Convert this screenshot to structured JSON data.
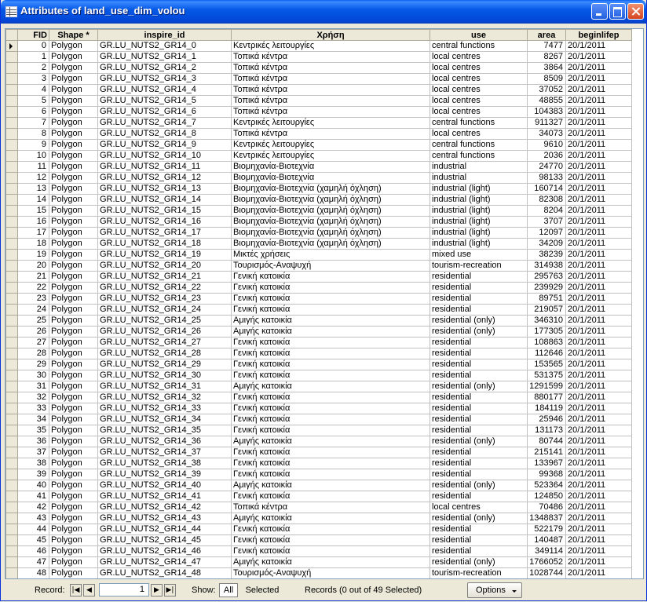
{
  "window": {
    "title": "Attributes of land_use_dim_volou"
  },
  "columns": [
    "FID",
    "Shape *",
    "inspire_id",
    "Χρήση",
    "use",
    "area",
    "beginlifep"
  ],
  "rows": [
    [
      "0",
      "Polygon",
      "GR.LU_NUTS2_GR14_0",
      "Κεντρικές λειτουργίες",
      "central functions",
      "7477",
      "20/1/2011"
    ],
    [
      "1",
      "Polygon",
      "GR.LU_NUTS2_GR14_1",
      "Τοπικά κέντρα",
      "local centres",
      "8267",
      "20/1/2011"
    ],
    [
      "2",
      "Polygon",
      "GR.LU_NUTS2_GR14_2",
      "Τοπικά κέντρα",
      "local centres",
      "3864",
      "20/1/2011"
    ],
    [
      "3",
      "Polygon",
      "GR.LU_NUTS2_GR14_3",
      "Τοπικά κέντρα",
      "local centres",
      "8509",
      "20/1/2011"
    ],
    [
      "4",
      "Polygon",
      "GR.LU_NUTS2_GR14_4",
      "Τοπικά κέντρα",
      "local centres",
      "37052",
      "20/1/2011"
    ],
    [
      "5",
      "Polygon",
      "GR.LU_NUTS2_GR14_5",
      "Τοπικά κέντρα",
      "local centres",
      "48855",
      "20/1/2011"
    ],
    [
      "6",
      "Polygon",
      "GR.LU_NUTS2_GR14_6",
      "Τοπικά κέντρα",
      "local centres",
      "104383",
      "20/1/2011"
    ],
    [
      "7",
      "Polygon",
      "GR.LU_NUTS2_GR14_7",
      "Κεντρικές λειτουργίες",
      "central functions",
      "911327",
      "20/1/2011"
    ],
    [
      "8",
      "Polygon",
      "GR.LU_NUTS2_GR14_8",
      "Τοπικά κέντρα",
      "local centres",
      "34073",
      "20/1/2011"
    ],
    [
      "9",
      "Polygon",
      "GR.LU_NUTS2_GR14_9",
      "Κεντρικές λειτουργίες",
      "central functions",
      "9610",
      "20/1/2011"
    ],
    [
      "10",
      "Polygon",
      "GR.LU_NUTS2_GR14_10",
      "Κεντρικές λειτουργίες",
      "central functions",
      "2036",
      "20/1/2011"
    ],
    [
      "11",
      "Polygon",
      "GR.LU_NUTS2_GR14_11",
      "Βιομηχανία-Βιοτεχνία",
      "industrial",
      "24770",
      "20/1/2011"
    ],
    [
      "12",
      "Polygon",
      "GR.LU_NUTS2_GR14_12",
      "Βιομηχανία-Βιοτεχνία",
      "industrial",
      "98133",
      "20/1/2011"
    ],
    [
      "13",
      "Polygon",
      "GR.LU_NUTS2_GR14_13",
      "Βιομηχανία-Βιοτεχνία (χαμηλή όχληση)",
      "industrial (light)",
      "160714",
      "20/1/2011"
    ],
    [
      "14",
      "Polygon",
      "GR.LU_NUTS2_GR14_14",
      "Βιομηχανία-Βιοτεχνία (χαμηλή όχληση)",
      "industrial (light)",
      "82308",
      "20/1/2011"
    ],
    [
      "15",
      "Polygon",
      "GR.LU_NUTS2_GR14_15",
      "Βιομηχανία-Βιοτεχνία (χαμηλή όχληση)",
      "industrial (light)",
      "8204",
      "20/1/2011"
    ],
    [
      "16",
      "Polygon",
      "GR.LU_NUTS2_GR14_16",
      "Βιομηχανία-Βιοτεχνία (χαμηλή όχληση)",
      "industrial (light)",
      "3707",
      "20/1/2011"
    ],
    [
      "17",
      "Polygon",
      "GR.LU_NUTS2_GR14_17",
      "Βιομηχανία-Βιοτεχνία (χαμηλή όχληση)",
      "industrial (light)",
      "12097",
      "20/1/2011"
    ],
    [
      "18",
      "Polygon",
      "GR.LU_NUTS2_GR14_18",
      "Βιομηχανία-Βιοτεχνία (χαμηλή όχληση)",
      "industrial (light)",
      "34209",
      "20/1/2011"
    ],
    [
      "19",
      "Polygon",
      "GR.LU_NUTS2_GR14_19",
      "Μικτές χρήσεις",
      "mixed use",
      "38239",
      "20/1/2011"
    ],
    [
      "20",
      "Polygon",
      "GR.LU_NUTS2_GR14_20",
      "Τουρισμός-Αναψυχή",
      "tourism-recreation",
      "314938",
      "20/1/2011"
    ],
    [
      "21",
      "Polygon",
      "GR.LU_NUTS2_GR14_21",
      "Γενική κατοικία",
      "residential",
      "295763",
      "20/1/2011"
    ],
    [
      "22",
      "Polygon",
      "GR.LU_NUTS2_GR14_22",
      "Γενική κατοικία",
      "residential",
      "239929",
      "20/1/2011"
    ],
    [
      "23",
      "Polygon",
      "GR.LU_NUTS2_GR14_23",
      "Γενική κατοικία",
      "residential",
      "89751",
      "20/1/2011"
    ],
    [
      "24",
      "Polygon",
      "GR.LU_NUTS2_GR14_24",
      "Γενική κατοικία",
      "residential",
      "219057",
      "20/1/2011"
    ],
    [
      "25",
      "Polygon",
      "GR.LU_NUTS2_GR14_25",
      "Αμιγής κατοικία",
      "residential (only)",
      "346310",
      "20/1/2011"
    ],
    [
      "26",
      "Polygon",
      "GR.LU_NUTS2_GR14_26",
      "Αμιγής κατοικία",
      "residential (only)",
      "177305",
      "20/1/2011"
    ],
    [
      "27",
      "Polygon",
      "GR.LU_NUTS2_GR14_27",
      "Γενική κατοικία",
      "residential",
      "108863",
      "20/1/2011"
    ],
    [
      "28",
      "Polygon",
      "GR.LU_NUTS2_GR14_28",
      "Γενική κατοικία",
      "residential",
      "112646",
      "20/1/2011"
    ],
    [
      "29",
      "Polygon",
      "GR.LU_NUTS2_GR14_29",
      "Γενική κατοικία",
      "residential",
      "153565",
      "20/1/2011"
    ],
    [
      "30",
      "Polygon",
      "GR.LU_NUTS2_GR14_30",
      "Γενική κατοικία",
      "residential",
      "531375",
      "20/1/2011"
    ],
    [
      "31",
      "Polygon",
      "GR.LU_NUTS2_GR14_31",
      "Αμιγής κατοικία",
      "residential (only)",
      "1291599",
      "20/1/2011"
    ],
    [
      "32",
      "Polygon",
      "GR.LU_NUTS2_GR14_32",
      "Γενική κατοικία",
      "residential",
      "880177",
      "20/1/2011"
    ],
    [
      "33",
      "Polygon",
      "GR.LU_NUTS2_GR14_33",
      "Γενική κατοικία",
      "residential",
      "184119",
      "20/1/2011"
    ],
    [
      "34",
      "Polygon",
      "GR.LU_NUTS2_GR14_34",
      "Γενική κατοικία",
      "residential",
      "25946",
      "20/1/2011"
    ],
    [
      "35",
      "Polygon",
      "GR.LU_NUTS2_GR14_35",
      "Γενική κατοικία",
      "residential",
      "131173",
      "20/1/2011"
    ],
    [
      "36",
      "Polygon",
      "GR.LU_NUTS2_GR14_36",
      "Αμιγής κατοικία",
      "residential (only)",
      "80744",
      "20/1/2011"
    ],
    [
      "37",
      "Polygon",
      "GR.LU_NUTS2_GR14_37",
      "Γενική κατοικία",
      "residential",
      "215141",
      "20/1/2011"
    ],
    [
      "38",
      "Polygon",
      "GR.LU_NUTS2_GR14_38",
      "Γενική κατοικία",
      "residential",
      "133967",
      "20/1/2011"
    ],
    [
      "39",
      "Polygon",
      "GR.LU_NUTS2_GR14_39",
      "Γενική κατοικία",
      "residential",
      "99368",
      "20/1/2011"
    ],
    [
      "40",
      "Polygon",
      "GR.LU_NUTS2_GR14_40",
      "Αμιγής κατοικία",
      "residential (only)",
      "523364",
      "20/1/2011"
    ],
    [
      "41",
      "Polygon",
      "GR.LU_NUTS2_GR14_41",
      "Γενική κατοικία",
      "residential",
      "124850",
      "20/1/2011"
    ],
    [
      "42",
      "Polygon",
      "GR.LU_NUTS2_GR14_42",
      "Τοπικά κέντρα",
      "local centres",
      "70486",
      "20/1/2011"
    ],
    [
      "43",
      "Polygon",
      "GR.LU_NUTS2_GR14_43",
      "Αμιγής κατοικία",
      "residential (only)",
      "1348837",
      "20/1/2011"
    ],
    [
      "44",
      "Polygon",
      "GR.LU_NUTS2_GR14_44",
      "Γενική κατοικία",
      "residential",
      "522179",
      "20/1/2011"
    ],
    [
      "45",
      "Polygon",
      "GR.LU_NUTS2_GR14_45",
      "Γενική κατοικία",
      "residential",
      "140487",
      "20/1/2011"
    ],
    [
      "46",
      "Polygon",
      "GR.LU_NUTS2_GR14_46",
      "Γενική κατοικία",
      "residential",
      "349114",
      "20/1/2011"
    ],
    [
      "47",
      "Polygon",
      "GR.LU_NUTS2_GR14_47",
      "Αμιγής κατοικία",
      "residential (only)",
      "1766052",
      "20/1/2011"
    ],
    [
      "48",
      "Polygon",
      "GR.LU_NUTS2_GR14_48",
      "Τουρισμός-Αναψυχή",
      "tourism-recreation",
      "1028744",
      "20/1/2011"
    ]
  ],
  "status": {
    "record_label": "Record:",
    "record_value": "1",
    "first_icon": "first-record-icon",
    "prev_icon": "prev-record-icon",
    "next_icon": "next-record-icon",
    "last_icon": "last-record-icon",
    "show_label": "Show:",
    "all_label": "All",
    "selected_label": "Selected",
    "records_info": "Records (0 out of 49 Selected)",
    "options_label": "Options"
  }
}
